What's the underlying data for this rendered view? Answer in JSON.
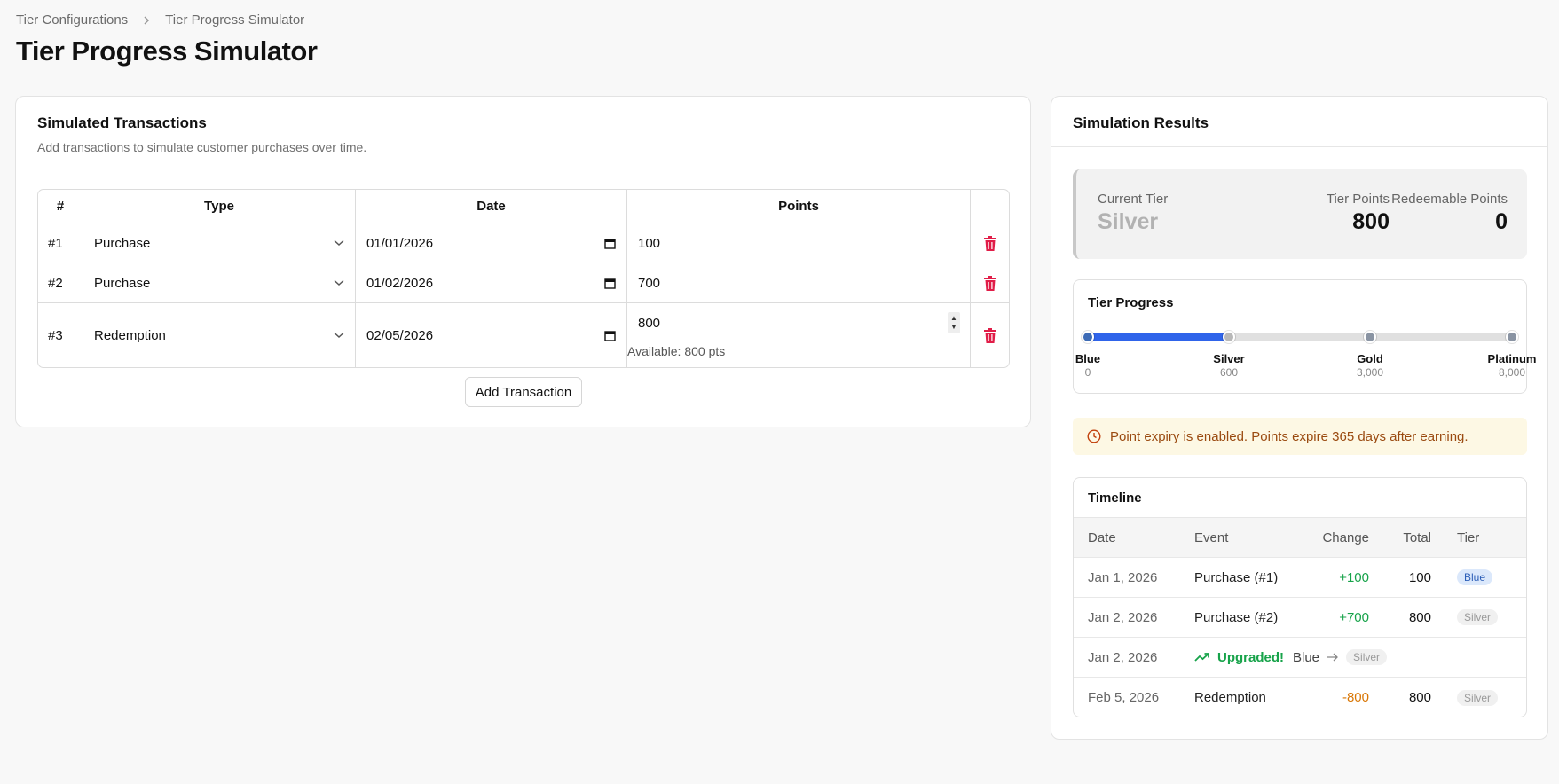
{
  "breadcrumb": {
    "parent": "Tier Configurations",
    "current": "Tier Progress Simulator"
  },
  "page": {
    "title": "Tier Progress Simulator"
  },
  "transactions": {
    "title": "Simulated Transactions",
    "description": "Add transactions to simulate customer purchases over time.",
    "headers": {
      "num": "#",
      "type": "Type",
      "date": "Date",
      "points": "Points"
    },
    "rows": [
      {
        "num": "#1",
        "type": "Purchase",
        "date": "01/01/2026",
        "points": "100"
      },
      {
        "num": "#2",
        "type": "Purchase",
        "date": "01/02/2026",
        "points": "700"
      },
      {
        "num": "#3",
        "type": "Redemption",
        "date": "02/05/2026",
        "points": "800",
        "available": "Available: 800 pts"
      }
    ],
    "add_label": "Add Transaction"
  },
  "results": {
    "title": "Simulation Results",
    "current_tier_label": "Current Tier",
    "current_tier": "Silver",
    "tier_points_label": "Tier Points",
    "tier_points": "800",
    "redeemable_label": "Redeemable Points",
    "redeemable": "0",
    "progress": {
      "title": "Tier Progress",
      "tiers": [
        {
          "name": "Blue",
          "threshold": "0",
          "color": "#3d6bb5"
        },
        {
          "name": "Silver",
          "threshold": "600",
          "color": "#b8b8b8"
        },
        {
          "name": "Gold",
          "threshold": "3,000",
          "color": "#8a94a3"
        },
        {
          "name": "Platinum",
          "threshold": "8,000",
          "color": "#8a94a3"
        }
      ],
      "fill_color": "#2f64ea"
    },
    "expiry_notice": "Point expiry is enabled. Points expire 365 days after earning.",
    "timeline": {
      "title": "Timeline",
      "headers": {
        "date": "Date",
        "event": "Event",
        "change": "Change",
        "total": "Total",
        "tier": "Tier"
      },
      "rows": [
        {
          "date": "Jan 1, 2026",
          "event": "Purchase (#1)",
          "change": "+100",
          "total": "100",
          "tier": "Blue"
        },
        {
          "date": "Jan 2, 2026",
          "event": "Purchase (#2)",
          "change": "+700",
          "total": "800",
          "tier": "Silver"
        },
        {
          "date": "Jan 2, 2026",
          "upgrade_label": "Upgraded!",
          "from_tier": "Blue",
          "to_tier": "Silver"
        },
        {
          "date": "Feb 5, 2026",
          "event": "Redemption",
          "change": "-800",
          "total": "800",
          "tier": "Silver"
        }
      ]
    }
  }
}
